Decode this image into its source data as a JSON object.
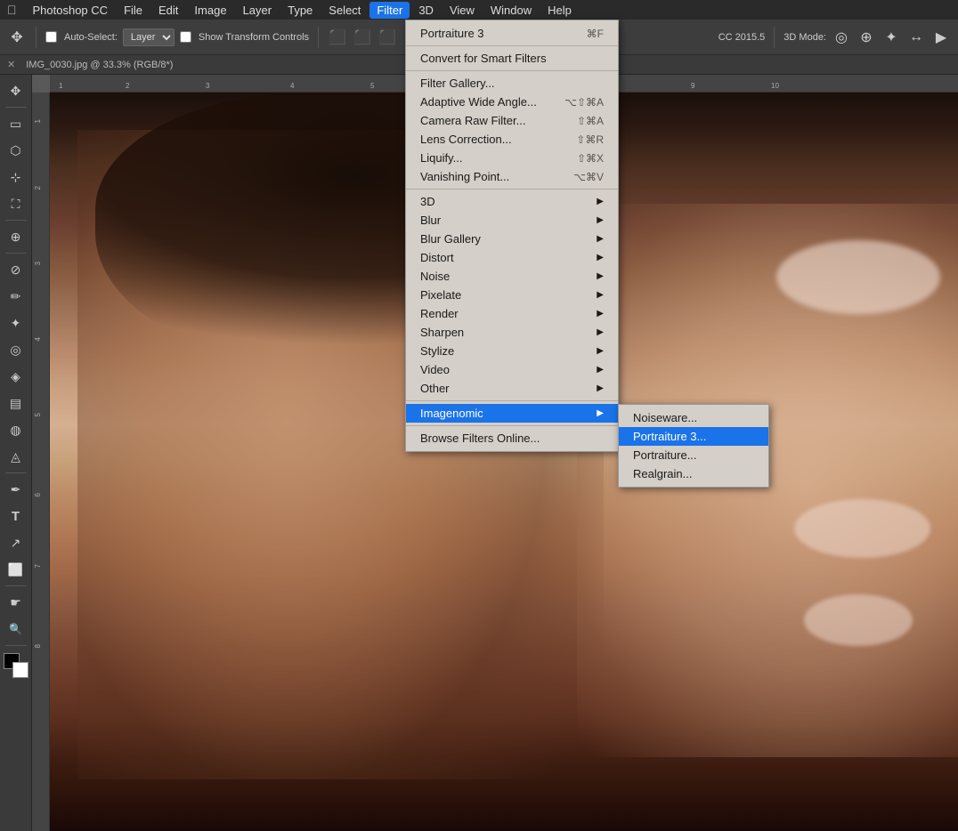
{
  "app": {
    "name": "Photoshop CC",
    "version": "CC 2015.5",
    "apple_label": "",
    "title_bar": "Photoshop CC"
  },
  "menubar": {
    "items": [
      {
        "label": "Photoshop CC",
        "active": false
      },
      {
        "label": "File",
        "active": false
      },
      {
        "label": "Edit",
        "active": false
      },
      {
        "label": "Image",
        "active": false
      },
      {
        "label": "Layer",
        "active": false
      },
      {
        "label": "Type",
        "active": false
      },
      {
        "label": "Select",
        "active": false
      },
      {
        "label": "Filter",
        "active": true
      },
      {
        "label": "3D",
        "active": false
      },
      {
        "label": "View",
        "active": false
      },
      {
        "label": "Window",
        "active": false
      },
      {
        "label": "Help",
        "active": false
      }
    ]
  },
  "toolbar": {
    "move_label": "Auto-Select:",
    "layer_label": "Layer",
    "show_transform": "Show Transform Controls",
    "version_label": "CC 2015.5",
    "mode_label": "3D Mode:"
  },
  "tabbar": {
    "tab_label": "IMG_0030.jpg @ 33.3% (RGB/8*)"
  },
  "filter_menu": {
    "title": "Filter",
    "items": [
      {
        "label": "Portraiture 3",
        "shortcut": "⌘F",
        "type": "item",
        "id": "portraiture3-top"
      },
      {
        "type": "separator"
      },
      {
        "label": "Convert for Smart Filters",
        "shortcut": "",
        "type": "item",
        "id": "convert-smart"
      },
      {
        "type": "separator"
      },
      {
        "label": "Filter Gallery...",
        "shortcut": "",
        "type": "item",
        "id": "filter-gallery"
      },
      {
        "label": "Adaptive Wide Angle...",
        "shortcut": "⌥⇧⌘A",
        "type": "item",
        "id": "adaptive-wide"
      },
      {
        "label": "Camera Raw Filter...",
        "shortcut": "⇧⌘A",
        "type": "item",
        "id": "camera-raw"
      },
      {
        "label": "Lens Correction...",
        "shortcut": "⇧⌘R",
        "type": "item",
        "id": "lens-correction"
      },
      {
        "label": "Liquify...",
        "shortcut": "⇧⌘X",
        "type": "item",
        "id": "liquify"
      },
      {
        "label": "Vanishing Point...",
        "shortcut": "⌥⌘V",
        "type": "item",
        "id": "vanishing-point"
      },
      {
        "type": "separator"
      },
      {
        "label": "3D",
        "shortcut": "",
        "type": "submenu",
        "id": "3d"
      },
      {
        "label": "Blur",
        "shortcut": "",
        "type": "submenu",
        "id": "blur"
      },
      {
        "label": "Blur Gallery",
        "shortcut": "",
        "type": "submenu",
        "id": "blur-gallery"
      },
      {
        "label": "Distort",
        "shortcut": "",
        "type": "submenu",
        "id": "distort"
      },
      {
        "label": "Noise",
        "shortcut": "",
        "type": "submenu",
        "id": "noise"
      },
      {
        "label": "Pixelate",
        "shortcut": "",
        "type": "submenu",
        "id": "pixelate"
      },
      {
        "label": "Render",
        "shortcut": "",
        "type": "submenu",
        "id": "render"
      },
      {
        "label": "Sharpen",
        "shortcut": "",
        "type": "submenu",
        "id": "sharpen"
      },
      {
        "label": "Stylize",
        "shortcut": "",
        "type": "submenu",
        "id": "stylize"
      },
      {
        "label": "Video",
        "shortcut": "",
        "type": "submenu",
        "id": "video"
      },
      {
        "label": "Other",
        "shortcut": "",
        "type": "submenu",
        "id": "other"
      },
      {
        "type": "separator"
      },
      {
        "label": "Imagenomic",
        "shortcut": "",
        "type": "submenu",
        "id": "imagenomic",
        "highlighted": true
      },
      {
        "type": "separator"
      },
      {
        "label": "Browse Filters Online...",
        "shortcut": "",
        "type": "item",
        "id": "browse-filters"
      }
    ]
  },
  "imagenomic_submenu": {
    "items": [
      {
        "label": "Noiseware...",
        "id": "noiseware"
      },
      {
        "label": "Portraiture 3...",
        "id": "portraiture3-sub",
        "highlighted": true
      },
      {
        "label": "Portraiture...",
        "id": "portraiture"
      },
      {
        "label": "Realgrain...",
        "id": "realgrain"
      }
    ]
  },
  "left_tools": [
    {
      "icon": "✥",
      "name": "move-tool"
    },
    {
      "icon": "▭",
      "name": "marquee-tool"
    },
    {
      "icon": "⬡",
      "name": "lasso-tool"
    },
    {
      "icon": "⊹",
      "name": "quick-select-tool"
    },
    {
      "icon": "✂",
      "name": "crop-tool"
    },
    {
      "icon": "⊟",
      "name": "slice-tool"
    },
    {
      "icon": "⊕",
      "name": "eyedropper-tool"
    },
    {
      "icon": "⊘",
      "name": "healing-tool"
    },
    {
      "icon": "✏",
      "name": "brush-tool"
    },
    {
      "icon": "⬛",
      "name": "clone-tool"
    },
    {
      "icon": "◎",
      "name": "history-tool"
    },
    {
      "icon": "◈",
      "name": "eraser-tool"
    },
    {
      "icon": "◻",
      "name": "gradient-tool"
    },
    {
      "icon": "◍",
      "name": "blur-tool"
    },
    {
      "icon": "◬",
      "name": "dodge-tool"
    },
    {
      "icon": "✒",
      "name": "pen-tool"
    },
    {
      "icon": "T",
      "name": "type-tool"
    },
    {
      "icon": "↗",
      "name": "path-select-tool"
    },
    {
      "icon": "⬜",
      "name": "shape-tool"
    },
    {
      "icon": "☛",
      "name": "hand-tool"
    },
    {
      "icon": "🔍",
      "name": "zoom-tool"
    }
  ],
  "colors": {
    "menubar_bg": "#2a2a2a",
    "toolbar_bg": "#3d3d3d",
    "canvas_bg": "#595959",
    "left_toolbar_bg": "#3a3a3a",
    "menu_bg": "#d4cfc8",
    "menu_highlight": "#1a73e8",
    "menu_border": "#999",
    "active_menu_item": "#1a73e8"
  }
}
